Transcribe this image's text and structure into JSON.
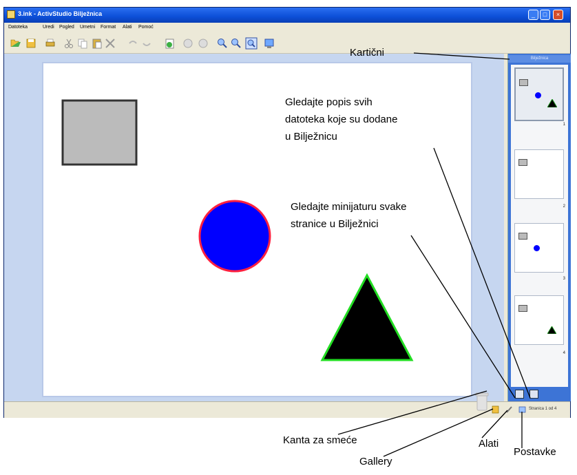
{
  "window": {
    "title": "3.ink - ActivStudio Bilježnica",
    "controls": [
      "_",
      "□",
      "×"
    ]
  },
  "menu": [
    "Datoteka",
    "Uredi",
    "Pogled",
    "Umetni",
    "Format",
    "Alati",
    "Pomoć"
  ],
  "toolbar": {
    "icons": [
      "open-icon",
      "save-icon",
      "print-icon",
      "cut-icon",
      "copy-icon",
      "paste-icon",
      "delete-icon",
      "undo-icon",
      "redo-icon",
      "insert-page-icon",
      "prev-page-icon",
      "next-page-icon",
      "zoom-in-icon",
      "zoom-out-icon",
      "zoom-fit-icon",
      "screen-icon"
    ]
  },
  "panel": {
    "header": "Bilježnica",
    "thumbnails": [
      {
        "number": "1",
        "selected": true
      },
      {
        "number": "2",
        "selected": false
      },
      {
        "number": "3",
        "selected": false
      },
      {
        "number": "4",
        "selected": false
      }
    ]
  },
  "statusbar": {
    "page_indicator": "Stranica 1 od 4"
  },
  "canvas": {
    "square_fill": "#bbbbbb",
    "circle_fill": "#0000ff",
    "circle_stroke": "#ff2040",
    "triangle_fill": "#000000",
    "triangle_stroke": "#22dd22"
  },
  "annotations": {
    "kartice": "Kartični",
    "files_line1": "Gledajte popis svih",
    "files_line2": "datoteka koje su dodane",
    "files_line3": "u Bilježnicu",
    "pages_line1": "Gledajte minijaturu svake",
    "pages_line2": "stranice u Bilježnici",
    "trash": "Kanta za smeće",
    "gallery": "Gallery",
    "tools": "Alati",
    "settings": "Postavke"
  }
}
